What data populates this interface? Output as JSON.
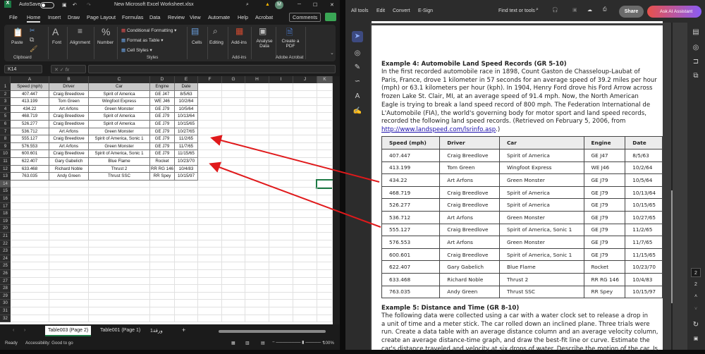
{
  "excel": {
    "autosave_label": "AutoSave",
    "file_title": "New Microsoft Excel Worksheet.xlsx",
    "avatar_initial": "M",
    "menu_tabs": [
      "File",
      "Home",
      "Insert",
      "Draw",
      "Page Layout",
      "Formulas",
      "Data",
      "Review",
      "View",
      "Automate",
      "Help",
      "Acrobat"
    ],
    "active_tab": "Home",
    "comments_label": "Comments",
    "ribbon": {
      "paste": "Paste",
      "clipboard": "Clipboard",
      "font": "Font",
      "alignment": "Alignment",
      "number": "Number",
      "conditional_formatting": "Conditional Formatting",
      "format_as_table": "Format as Table",
      "cell_styles": "Cell Styles",
      "styles": "Styles",
      "cells": "Cells",
      "editing": "Editing",
      "add_ins": "Add-ins",
      "add_ins_group": "Add-ins",
      "analyse_data": "Analyse Data",
      "create_pdf": "Create a PDF",
      "adobe_acrobat": "Adobe Acrobat"
    },
    "name_box": "K14",
    "fx_label": "fx",
    "columns": [
      "A",
      "B",
      "C",
      "D",
      "E",
      "F",
      "G",
      "H",
      "I",
      "J",
      "K"
    ],
    "selected_cell": "K14",
    "table": {
      "headers": [
        "Speed (mph)",
        "Driver",
        "Car",
        "Engine",
        "Date"
      ],
      "rows": [
        [
          "407.447",
          "Craig Breedlove",
          "Spirit of America",
          "GE J47",
          "8/5/63"
        ],
        [
          "413.199",
          "Tom Green",
          "Wingfoot Express",
          "WE J46",
          "10/2/64"
        ],
        [
          "434.22",
          "Art Arfons",
          "Green Monster",
          "GE J79",
          "10/5/64"
        ],
        [
          "468.719",
          "Craig Breedlove",
          "Spirit of America",
          "GE J79",
          "10/13/64"
        ],
        [
          "526.277",
          "Craig Breedlove",
          "Spirit of America",
          "GE J79",
          "10/15/65"
        ],
        [
          "536.712",
          "Art Arfons",
          "Green Monster",
          "GE J79",
          "10/27/65"
        ],
        [
          "555.127",
          "Craig Breedlove",
          "Spirit of America, Sonic 1",
          "GE J79",
          "11/2/65"
        ],
        [
          "576.553",
          "Art Arfons",
          "Green Monster",
          "GE J79",
          "11/7/65"
        ],
        [
          "600.601",
          "Craig Breedlove",
          "Spirit of America, Sonic 1",
          "GE J79",
          "11/15/65"
        ],
        [
          "622.407",
          "Gary Gabelich",
          "Blue Flame",
          "Rocket",
          "10/23/70"
        ],
        [
          "633.468",
          "Richard Noble",
          "Thrust 2",
          "RR RG 146",
          "10/4/83"
        ],
        [
          "763.035",
          "Andy Green",
          "Thrust SSC",
          "RR Spey",
          "10/15/97"
        ]
      ]
    },
    "sheet_tabs": [
      "Table003 (Page 2)",
      "Table001 (Page 1)",
      "ورقة1"
    ],
    "active_sheet": "Table003 (Page 2)",
    "status": "Ready",
    "accessibility": "Accessibility: Good to go",
    "zoom": "100%"
  },
  "acrobat": {
    "menu": [
      "All tools",
      "Edit",
      "Convert",
      "E-Sign"
    ],
    "find": "Find text or tools",
    "share": "Share",
    "ai_assistant": "Ask AI Assistant",
    "page_current": "2",
    "page_total": "2",
    "example4_title": "Example 4: Automobile Land Speed Records (GR 5-10)",
    "example4_lines": [
      "In the first recorded automobile race in 1898, Count Gaston de Chasseloup-Laubat of",
      "Paris, France, drove 1 kilometer in 57 seconds for an average speed of 39.2 miles per hour",
      "(mph) or 63.1 kilometers per hour (kph). In 1904, Henry Ford drove his Ford Arrow across",
      "frozen Lake St. Clair, MI, at an average speed of 91.4 mph. Now, the North American",
      "Eagle is trying to break a land speed record of 800 mph. The Federation International de",
      "L'Automobile (FIA), the world's governing body for motor sport and land speed records,",
      "recorded the following land speed records. (Retrieved on February 5, 2006, from"
    ],
    "link": "http://www.landspeed.com/lsrinfo.asp",
    "link_suffix": ".)",
    "table_headers": [
      "Speed (mph)",
      "Driver",
      "Car",
      "Engine",
      "Date"
    ],
    "example5_title": "Example 5: Distance and Time (GR 8-10)",
    "example5_lines": [
      "The following data were collected using a car with a water clock set to release a drop in",
      "a unit of time and a meter stick. The car rolled down an inclined plane. Three trials were",
      "run. Create a data table with an average distance column and an average velocity column,",
      "create an average distance-time graph, and draw the best-fit line or curve. Estimate the",
      "car's distance traveled and velocity at six drops of water. Describe the motion of the car. Is"
    ]
  },
  "annotation_color": "#e0191b"
}
